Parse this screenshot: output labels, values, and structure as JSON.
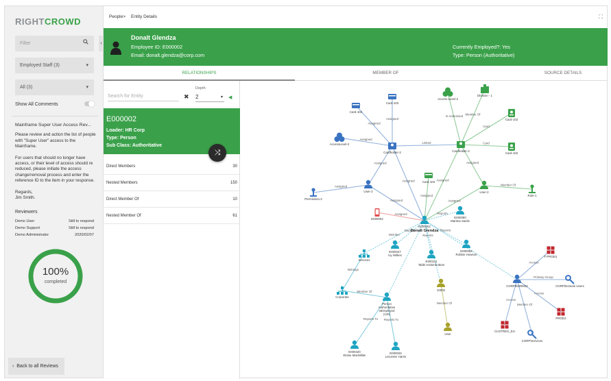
{
  "left": {
    "logo_a": "RIGHT",
    "logo_b": "CROWD",
    "filter_placeholder": "Filter",
    "staff_select": "Employed Staff (3)",
    "all_select": "All (3)",
    "show_comments": "Show All Comments",
    "review_title": "Mainframe Super User Access Rev...",
    "msg_p1": "Please review and action the list of people with \"Super User\" access to the Mainframe.",
    "msg_p2": "For users that should no longer have access, or their level of access should re reduced, please initiate the access change/removal process and enter the reference ID to the item in your response.",
    "msg_regards": "Regards,",
    "msg_sign": "Jim Smith.",
    "reviewers_title": "Reviewers",
    "reviewers": [
      {
        "name": "Demo User",
        "status": "Still to respond"
      },
      {
        "name": "Demo Support",
        "status": "Still to respond"
      },
      {
        "name": "Demo Administrator",
        "status": "2020/02/07"
      }
    ],
    "progress": {
      "value": 100,
      "label": "100%",
      "caption": "completed"
    },
    "back_label": "Back to all Reviews"
  },
  "breadcrumb": {
    "parent": "People",
    "sep": ">",
    "current": "Entity Details"
  },
  "banner": {
    "name": "Donalt Glendza",
    "employee_id": "Employee ID: E000002",
    "email": "Email: donalt.glendza@corp.com",
    "employed": "Currently Employed?: Yes",
    "type": "Type: Person (Authoritative)"
  },
  "tabs": [
    "RELATIONSHIPS",
    "MEMBER OF",
    "SOURCE DETAILS"
  ],
  "entity_panel": {
    "search_placeholder": "Search for Entity",
    "depth_label": "Depth",
    "depth_value": "2",
    "card": {
      "id": "E000002",
      "loader": "Loader: HR Corp",
      "type": "Type: Person",
      "subclass": "Sub Class: Authoritative"
    },
    "rows": [
      {
        "label": "Direct Members",
        "value": "30"
      },
      {
        "label": "Nested Members",
        "value": "150"
      },
      {
        "label": "Direct Member Of",
        "value": "10"
      },
      {
        "label": "Nested Member Of",
        "value": "61"
      }
    ]
  },
  "colors": {
    "green": "#3aa14a",
    "blue": "#3a73c1",
    "teal": "#1ea4c2",
    "red": "#c0262d",
    "olive": "#a8a12b"
  },
  "graph": {
    "nodes": [
      {
        "id": "center",
        "label": "Donalt Glendza",
        "icon": "person-icon",
        "color": "#1ea4c2",
        "sub": "E000002"
      },
      {
        "id": "card102a",
        "label": "Card-102",
        "icon": "card-icon",
        "color": "#3a73c1"
      },
      {
        "id": "card103a",
        "label": "Card-103",
        "icon": "card-icon",
        "color": "#3a73c1"
      },
      {
        "id": "accesslevel2a",
        "label": "Access Level-2",
        "icon": "group-icon",
        "color": "#3aa14a"
      },
      {
        "id": "division1",
        "label": "Division - 1",
        "icon": "building-icon",
        "color": "#3aa14a"
      },
      {
        "id": "card102b",
        "label": "Card-102",
        "icon": "badge-icon",
        "color": "#3aa14a"
      },
      {
        "id": "accesslevel2b",
        "label": "AccessLevel-2",
        "icon": "group-icon",
        "color": "#3a73c1"
      },
      {
        "id": "cardholder2a",
        "label": "Cardholder-2",
        "icon": "cardholder-icon",
        "color": "#3a73c1"
      },
      {
        "id": "cardholder2b",
        "label": "Cardholder-2",
        "icon": "cardholder-icon",
        "color": "#3aa14a"
      },
      {
        "id": "card102c",
        "label": "Card-102",
        "icon": "badge-icon",
        "color": "#3aa14a"
      },
      {
        "id": "user2a",
        "label": "User-2",
        "icon": "person-icon",
        "color": "#3a73c1"
      },
      {
        "id": "card103b",
        "label": "Card-103",
        "icon": "card-icon",
        "color": "#3aa14a"
      },
      {
        "id": "user2b",
        "label": "User-2",
        "icon": "person-icon",
        "color": "#3aa14a"
      },
      {
        "id": "role1",
        "label": "Role-1",
        "icon": "role-icon",
        "color": "#3aa14a"
      },
      {
        "id": "permission2",
        "label": "Permission-2",
        "icon": "role-icon",
        "color": "#3a73c1"
      },
      {
        "id": "phone",
        "label": "E000002",
        "icon": "phone-icon",
        "color": "#e24b4b"
      },
      {
        "id": "martina",
        "label": "E000080\nMartina Savile",
        "icon": "person-icon",
        "color": "#1ea4c2"
      },
      {
        "id": "services",
        "label": "Services",
        "icon": "org-icon",
        "color": "#1ea4c2"
      },
      {
        "id": "ivy",
        "label": "E000047\nIvy Wilkes",
        "icon": "person-icon",
        "color": "#1ea4c2"
      },
      {
        "id": "tabbi",
        "label": "E000111\nTabbi Hickenbottom",
        "icon": "person-icon",
        "color": "#1ea4c2"
      },
      {
        "id": "robbie",
        "label": "E000065\nRobbie Howson",
        "icon": "person-icon",
        "color": "#1ea4c2"
      },
      {
        "id": "corporate",
        "label": "Corporate",
        "icon": "org-icon",
        "color": "#1ea4c2"
      },
      {
        "id": "persontype",
        "label": "Person\nAuthoritative\nIsEmployed\n(146)",
        "icon": "person-icon",
        "color": "#1ea4c2"
      },
      {
        "id": "n10002",
        "label": "10002",
        "icon": "person-icon",
        "color": "#a8a12b"
      },
      {
        "id": "userolive",
        "label": "User",
        "icon": "person-icon",
        "color": "#a8a12b"
      },
      {
        "id": "eloise",
        "label": "E000420\nEloise MacMillan",
        "icon": "person-icon",
        "color": "#1ea4c2"
      },
      {
        "id": "leicester",
        "label": "E000026\nLeicester Harris",
        "icon": "person-icon",
        "color": "#1ea4c2"
      },
      {
        "id": "corpe",
        "label": "CORP\\E000002",
        "icon": "person-icon",
        "color": "#3a73c1"
      },
      {
        "id": "prod1",
        "label": "F:PROD1",
        "icon": "app-icon",
        "color": "#c0262d"
      },
      {
        "id": "domusers",
        "label": "CORP\\Domain Users",
        "icon": "key-icon",
        "color": "#3a73c1"
      },
      {
        "id": "prod2",
        "label": "PROD2",
        "icon": "app-icon",
        "color": "#c0262d"
      },
      {
        "id": "custreg",
        "label": "CUSTREG_EU",
        "icon": "app-icon",
        "color": "#c0262d"
      },
      {
        "id": "corpservices",
        "label": "CORP\\Services",
        "icon": "key-icon",
        "color": "#3a73c1"
      }
    ],
    "edges": [
      {
        "from": "card102a",
        "to": "cardholder2a",
        "label": "Assigned"
      },
      {
        "from": "card103a",
        "to": "cardholder2a",
        "label": "Assigned"
      },
      {
        "from": "accesslevel2b",
        "to": "cardholder2a",
        "label": "Assigned"
      },
      {
        "from": "cardholder2a",
        "to": "cardholder2b",
        "label": "Linked"
      },
      {
        "from": "accesslevel2a",
        "to": "cardholder2b",
        "label": "Is Authorised"
      },
      {
        "from": "division1",
        "to": "cardholder2b",
        "label": "Member Of"
      },
      {
        "from": "card102b",
        "to": "cardholder2b",
        "label": "Card"
      },
      {
        "from": "card102c",
        "to": "cardholder2b",
        "label": "Card"
      },
      {
        "from": "cardholder2a",
        "to": "user2a",
        "label": "Assigned"
      },
      {
        "from": "cardholder2b",
        "to": "user2b",
        "label": "Assigned"
      },
      {
        "from": "user2a",
        "to": "permission2",
        "label": "Assigned"
      },
      {
        "from": "user2b",
        "to": "role1",
        "label": "Member Of"
      },
      {
        "from": "card103b",
        "to": "center",
        "label": "Assigned"
      },
      {
        "from": "cardholder2a",
        "to": "center",
        "label": "Assigned"
      },
      {
        "from": "cardholder2b",
        "to": "center",
        "label": "Assigned"
      },
      {
        "from": "user2a",
        "to": "center",
        "label": "Assigned"
      },
      {
        "from": "user2b",
        "to": "center",
        "label": "Assigned"
      },
      {
        "from": "phone",
        "to": "center",
        "label": "Assigned"
      },
      {
        "from": "martina",
        "to": "center",
        "label": "Reports"
      },
      {
        "from": "center",
        "to": "services",
        "label": "Member"
      },
      {
        "from": "ivy",
        "to": "center",
        "label": "Reports"
      },
      {
        "from": "tabbi",
        "to": "center",
        "label": "Reports"
      },
      {
        "from": "robbie",
        "to": "center",
        "label": "Reports"
      },
      {
        "from": "services",
        "to": "corporate",
        "label": "Belongs"
      },
      {
        "from": "persontype",
        "to": "corporate",
        "label": "Member Of"
      },
      {
        "from": "center",
        "to": "persontype",
        "label": ""
      },
      {
        "from": "center",
        "to": "n10002",
        "label": ""
      },
      {
        "from": "n10002",
        "to": "userolive",
        "label": "Member Of"
      },
      {
        "from": "eloise",
        "to": "persontype",
        "label": "Reports To"
      },
      {
        "from": "leicester",
        "to": "persontype",
        "label": "Reports To"
      },
      {
        "from": "center",
        "to": "corpe",
        "label": ""
      },
      {
        "from": "corpe",
        "to": "prod1",
        "label": "Access"
      },
      {
        "from": "corpe",
        "to": "domusers",
        "label": "Primary Group"
      },
      {
        "from": "corpe",
        "to": "prod2",
        "label": "Access"
      },
      {
        "from": "corpe",
        "to": "custreg",
        "label": "Access"
      },
      {
        "from": "corpe",
        "to": "corpservices",
        "label": "Member Of"
      }
    ]
  }
}
